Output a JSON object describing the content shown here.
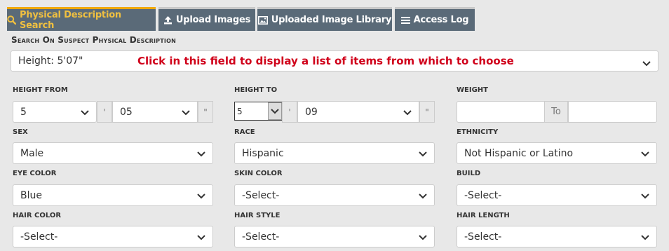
{
  "tabs": [
    {
      "label": "Physical Description Search",
      "icon": "search-icon",
      "active": true
    },
    {
      "label": "Upload Images",
      "icon": "upload-icon",
      "active": false
    },
    {
      "label": "Uploaded Image Library",
      "icon": "image-icon",
      "active": false
    },
    {
      "label": "Access Log",
      "icon": "list-icon",
      "active": false
    }
  ],
  "section_title": "Search On Suspect Physical Description",
  "search": {
    "value": "Height: 5'07\"",
    "hint": "Click in this field to display a list of items from which to choose"
  },
  "height_from": {
    "label": "Height From",
    "feet": "5",
    "feet_unit": "'",
    "inches": "05",
    "inches_unit": "\""
  },
  "height_to": {
    "label": "Height To",
    "feet": "5",
    "feet_unit": "'",
    "inches": "09",
    "inches_unit": "\""
  },
  "weight": {
    "label": "Weight",
    "separator": "To"
  },
  "sex": {
    "label": "Sex",
    "value": "Male"
  },
  "race": {
    "label": "Race",
    "value": "Hispanic"
  },
  "ethnicity": {
    "label": "Ethnicity",
    "value": "Not Hispanic or Latino"
  },
  "eye_color": {
    "label": "Eye Color",
    "value": "Blue"
  },
  "skin_color": {
    "label": "Skin Color",
    "value": "-Select-"
  },
  "build": {
    "label": "Build",
    "value": "-Select-"
  },
  "hair_color": {
    "label": "Hair Color",
    "value": "-Select-"
  },
  "hair_style": {
    "label": "Hair Style",
    "value": "-Select-"
  },
  "hair_length": {
    "label": "Hair Length",
    "value": "-Select-"
  },
  "colors": {
    "tab_bg": "#5a6a78",
    "tab_active_text": "#f0c040",
    "tab_active_border": "#f0a800",
    "hint": "#d0021b",
    "page_bg": "#e8e8e8"
  }
}
